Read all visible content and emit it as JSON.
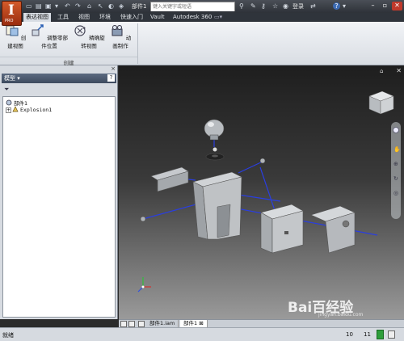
{
  "app": {
    "logo_letter": "I",
    "logo_sub": "PRO",
    "document_name": "部件1"
  },
  "search": {
    "placeholder": "键入关键字或短语"
  },
  "title_bar": {
    "login_label": "登录",
    "help_label": "?"
  },
  "ribbon_tabs": [
    {
      "label": "表达视图",
      "active": true
    },
    {
      "label": "工具",
      "active": false
    },
    {
      "label": "视图",
      "active": false
    },
    {
      "label": "环境",
      "active": false
    },
    {
      "label": "快速入门",
      "active": false
    },
    {
      "label": "Vault",
      "active": false
    },
    {
      "label": "Autodesk 360",
      "active": false
    }
  ],
  "ribbon": {
    "buttons": [
      {
        "label": "创建视图",
        "icon": "create-view-icon"
      },
      {
        "label": "调整零部件位置",
        "icon": "tweak-components-icon"
      },
      {
        "label": "精确旋转视图",
        "icon": "precise-rotate-icon"
      },
      {
        "label": "动画制作",
        "icon": "animate-icon"
      }
    ],
    "panel_name": "创建"
  },
  "browser": {
    "title": "模型",
    "help_label": "?",
    "close_label": "×",
    "tree": [
      {
        "label": "部件1",
        "level": 0,
        "icon": "assembly-icon"
      },
      {
        "label": "Explosion1",
        "level": 1,
        "icon": "explosion-icon",
        "expander": "+"
      }
    ]
  },
  "document_tabs": [
    {
      "label": "部件1.iam",
      "active": false
    },
    {
      "label": "部件1",
      "active": true
    }
  ],
  "status": {
    "text": "就绪",
    "count_a": "10",
    "count_b": "11"
  },
  "watermark": {
    "brand": "Bai百经验",
    "url": "jingyan.baidu.com"
  },
  "colors": {
    "accent": "#d35b2a",
    "explode_line": "#2a3ee0",
    "status_green": "#2e9e3b"
  }
}
